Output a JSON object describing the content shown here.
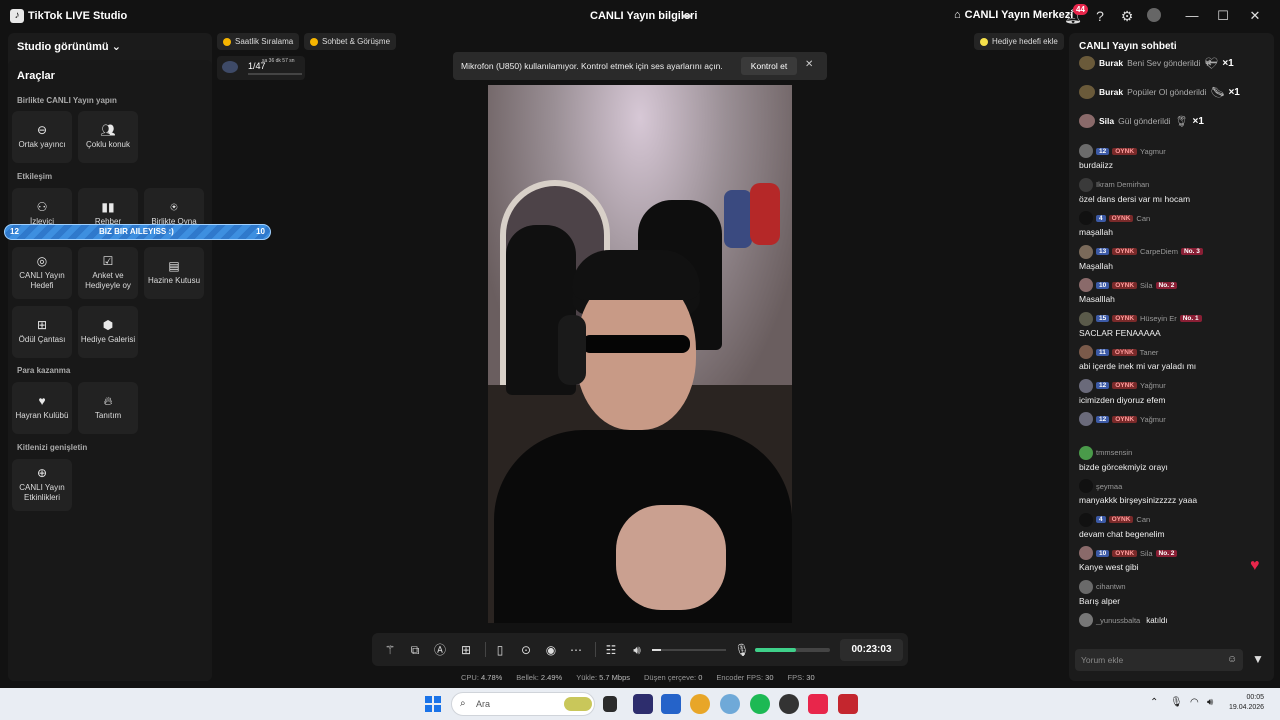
{
  "app": {
    "title": "TikTok LIVE Studio",
    "live_info": "CANLI Yayın bilgileri",
    "live_center": "CANLI Yayın Merkezi",
    "notification_count": "44"
  },
  "left": {
    "studio_view": "Studio görünümü",
    "tools_title": "Araçlar",
    "sections": {
      "together": "Birlikte CANLI Yayın yapın",
      "engagement": "Etkileşim",
      "monetize": "Para kazanma",
      "audience": "Kitlenizi genişletin"
    },
    "tools": {
      "cohost": "Ortak yayıncı",
      "multi_guest": "Çoklu konuk",
      "viewer": "İzleyici",
      "guide": "Rehber",
      "play_together": "Birlikte Oyna",
      "live_goal": "CANLI Yayın Hedefi",
      "poll": "Anket ve Hediyeyle oy",
      "treasure": "Hazine Kutusu",
      "reward_bag": "Ödül Çantası",
      "gift_gallery": "Hediye Galerisi",
      "fan_club": "Hayran Kulübü",
      "promote": "Tanıtım",
      "live_events": "CANLI Yayın Etkinlikleri"
    }
  },
  "pk_bar": {
    "left_score": "12",
    "label": "BIZ BIR AILEYISS :)",
    "right_score": "10"
  },
  "chips": {
    "hourly_ranking": "Saatlik Sıralama",
    "chat_meet": "Sohbet & Görüşme",
    "gift_goal": "Hediye hedefi ekle"
  },
  "goal_widget": {
    "count": "1/47",
    "time": "sa 36 dk 57 sn"
  },
  "toast": {
    "message": "Mikrofon (U850) kullanılamıyor. Kontrol etmek için ses ayarlarını açın.",
    "button": "Kontrol et"
  },
  "controls": {
    "timer": "00:23:03",
    "volume_level": 0.12,
    "mic_level": 0.55
  },
  "stats": {
    "cpu": "CPU:",
    "cpu_val": "4.78%",
    "mem": "Bellek:",
    "mem_val": "2.49%",
    "upload": "Yükle:",
    "upload_val": "5.7 Mbps",
    "dropped": "Düşen çerçeve:",
    "dropped_val": "0",
    "encoder_fps": "Encoder FPS:",
    "encoder_fps_val": "30",
    "fps": "FPS:",
    "fps_val": "30"
  },
  "chat": {
    "title": "CANLI Yayın sohbeti",
    "gifts": [
      {
        "name": "Burak",
        "text": "Beni Sev gönderildi",
        "mult": "×1"
      },
      {
        "name": "Burak",
        "text": "Popüler Ol gönderildi",
        "mult": "×1"
      },
      {
        "name": "Sila",
        "text": "Gül gönderildi",
        "mult": "×1"
      }
    ],
    "messages": [
      {
        "level": "12",
        "fan": "OYNK",
        "user": "Yagmur",
        "text": "burdaiizz"
      },
      {
        "user": "Ikram Demirhan",
        "text": "özel dans dersi var mı hocam"
      },
      {
        "level": "4",
        "fan": "OYNK",
        "user": "Can",
        "text": "maşallah"
      },
      {
        "level": "13",
        "fan": "OYNK",
        "user": "CarpeDiem",
        "rank": "No. 3",
        "text": "Maşallah"
      },
      {
        "level": "10",
        "fan": "OYNK",
        "user": "Sila",
        "rank": "No. 2",
        "text": "Masalllah"
      },
      {
        "level": "15",
        "fan": "OYNK",
        "user": "Hüseyin Er",
        "rank": "No. 1",
        "text": "SACLAR FENAAAAA"
      },
      {
        "level": "11",
        "fan": "OYNK",
        "user": "Taner",
        "text": "abi içerde inek mi var yaladı mı"
      },
      {
        "level": "12",
        "fan": "OYNK",
        "user": "Yağmur",
        "text": "icimizden diyoruz efem"
      },
      {
        "level": "12",
        "fan": "OYNK",
        "user": "Yağmur",
        "text": ""
      },
      {
        "user": "tmmsensin",
        "text": "bizde görcekmiyiz orayı"
      },
      {
        "user": "şeymaa",
        "text": "manyakkk birşeysinizzzzz yaaa"
      },
      {
        "level": "4",
        "fan": "OYNK",
        "user": "Can",
        "text": "devam chat begenelim"
      },
      {
        "level": "10",
        "fan": "OYNK",
        "user": "Sila",
        "rank": "No. 2",
        "text": "Kanye west gibi"
      },
      {
        "user": "cihantwn",
        "text": "Barış alper"
      },
      {
        "user": "_yunussbalta",
        "text": "katıldı"
      }
    ],
    "input_placeholder": "Yorum ekle"
  },
  "taskbar": {
    "search_label": "Ara",
    "time": "00:05",
    "date": "19.04.2026"
  },
  "colors": {
    "accent_red": "#e8264b",
    "mic_green": "#3fd08a",
    "level_blue": "#3c5aa6"
  }
}
